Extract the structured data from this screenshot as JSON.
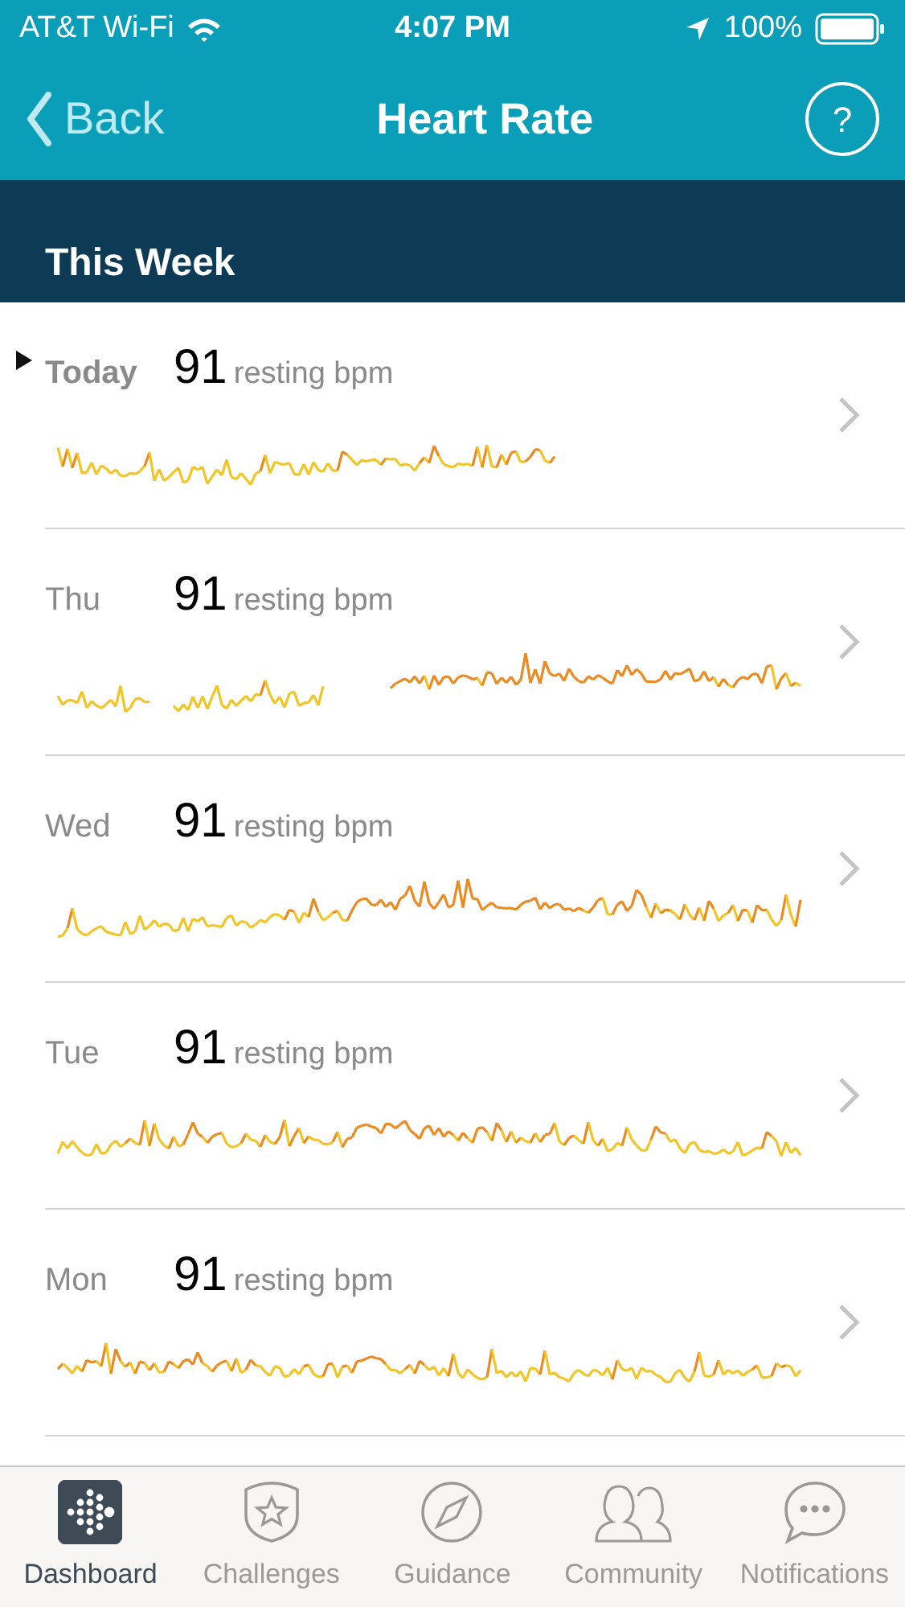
{
  "status_bar": {
    "carrier": "AT&T Wi-Fi",
    "time": "4:07 PM",
    "battery": "100%"
  },
  "nav": {
    "back": "Back",
    "title": "Heart Rate",
    "help": "?"
  },
  "section": {
    "title": "This Week"
  },
  "days": [
    {
      "label": "Today",
      "value": "91",
      "unit": "resting bpm",
      "current": true
    },
    {
      "label": "Thu",
      "value": "91",
      "unit": "resting bpm",
      "current": false
    },
    {
      "label": "Wed",
      "value": "91",
      "unit": "resting bpm",
      "current": false
    },
    {
      "label": "Tue",
      "value": "91",
      "unit": "resting bpm",
      "current": false
    },
    {
      "label": "Mon",
      "value": "91",
      "unit": "resting bpm",
      "current": false
    }
  ],
  "tabs": [
    {
      "label": "Dashboard",
      "kind": "dashboard",
      "selected": true
    },
    {
      "label": "Challenges",
      "kind": "challenges",
      "selected": false
    },
    {
      "label": "Guidance",
      "kind": "guidance",
      "selected": false
    },
    {
      "label": "Community",
      "kind": "community",
      "selected": false
    },
    {
      "label": "Notifications",
      "kind": "notifications",
      "selected": false
    }
  ]
}
